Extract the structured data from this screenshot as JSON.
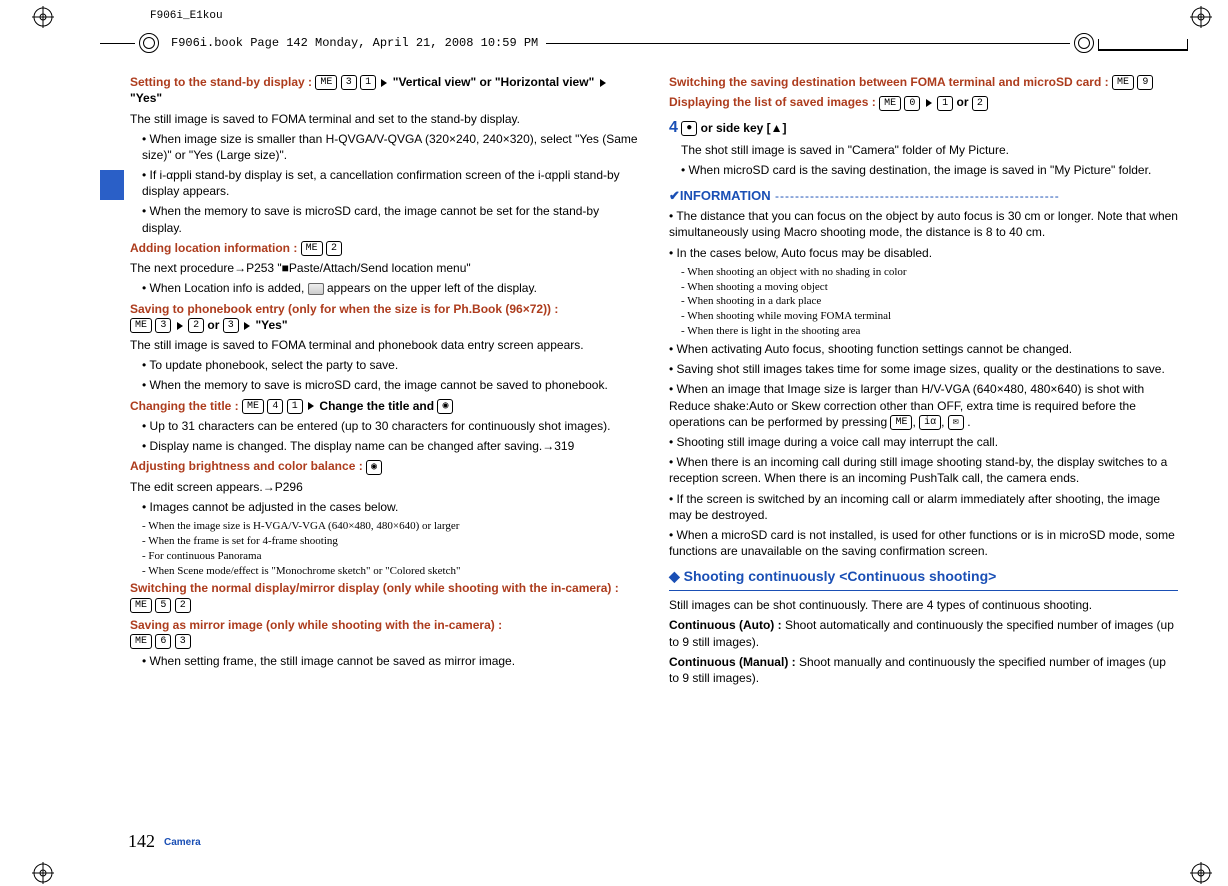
{
  "header": {
    "label": "F906i_E1kou"
  },
  "bookbar": {
    "text": "F906i.book  Page 142  Monday, April 21, 2008  10:59 PM"
  },
  "footer": {
    "num": "142",
    "cat": "Camera"
  },
  "left": {
    "standby_head": "Setting to the stand-by display : ",
    "standby_tail1": "\"Vertical view\" or \"Horizontal view\"",
    "standby_tail2": "\"Yes\"",
    "p1": "The still image is saved to FOMA terminal and set to the stand-by display.",
    "b1": "When image size is smaller than H-QVGA/V-QVGA (320×240, 240×320), select \"Yes (Same size)\" or \"Yes (Large size)\".",
    "b2a": "If i-",
    "b2b": "ppli stand-by display is set, a cancellation confirmation screen of the i-",
    "b2c": "ppli stand-by display appears.",
    "b3": "When the memory to save is microSD card, the image cannot be set for the stand-by display.",
    "addloc_head": "Adding location information : ",
    "addloc_p": "The next procedure→P253 \"■Paste/Attach/Send location menu\"",
    "addloc_b": "When Location info is added, ",
    "addloc_b2": " appears on the upper left of the display.",
    "savepb_head": "Saving to phonebook entry (only for when the size is for Ph.Book (96×72)) : ",
    "savepb_or": " or ",
    "savepb_yes": "\"Yes\"",
    "savepb_p": "The still image is saved to FOMA terminal and phonebook data entry screen appears.",
    "savepb_b1": "To update phonebook, select the party to save.",
    "savepb_b2": "When the memory to save is microSD card, the image cannot be saved to phonebook.",
    "chtitle_head": "Changing the title : ",
    "chtitle_tail": "Change the title and ",
    "chtitle_b1": "Up to 31 characters can be entered (up to 30 characters for continuously shot images).",
    "chtitle_b2": "Display name is changed. The display name can be changed after saving.→319",
    "adj_head": "Adjusting brightness and color balance : ",
    "adj_p": "The edit screen appears.→P296",
    "adj_b": "Images cannot be adjusted in the cases below.",
    "adj_s1": "- When the image size is H-VGA/V-VGA (640×480, 480×640) or larger",
    "adj_s2": "- When the frame is set for 4-frame shooting",
    "adj_s3": "- For continuous Panorama",
    "adj_s4": "- When Scene mode/effect is \"Monochrome sketch\" or \"Colored sketch\"",
    "mirror_head": "Switching the normal display/mirror display (only while shooting with the in-camera) : ",
    "savemirror_head": "Saving as mirror image (only while shooting with the in-camera) : ",
    "savemirror_b": "When setting frame, the still image cannot be saved as mirror image."
  },
  "right": {
    "switchdest_head": "Switching the saving destination between FOMA terminal and microSD card : ",
    "displist_head": "Displaying the list of saved images : ",
    "displist_or": " or ",
    "step4_btn": " or side key [▲]",
    "step4_p": "The shot still image is saved in \"Camera\" folder of My Picture.",
    "step4_b": "When microSD card is the saving destination, the image is saved in \"My Picture\" folder.",
    "info_title": "✔INFORMATION",
    "info_dash": " ---------------------------------------------------------",
    "i1": "The distance that you can focus on the object by auto focus is 30 cm or longer. Note that when simultaneously using Macro shooting mode, the distance is 8 to 40 cm.",
    "i2": "In the cases below, Auto focus may be disabled.",
    "i2s1": "- When shooting an object with no shading in color",
    "i2s2": "- When shooting a moving object",
    "i2s3": "- When shooting in a dark place",
    "i2s4": "- When shooting while moving FOMA terminal",
    "i2s5": "- When there is light in the shooting area",
    "i3": "When activating Auto focus, shooting function settings cannot be changed.",
    "i4": "Saving shot still images takes time for some image sizes, quality or the destinations to save.",
    "i5a": "When an image that Image size is larger than H/V-VGA (640×480, 480×640) is shot with Reduce shake:Auto or Skew correction other than OFF, extra time is required before the operations can be performed by pressing ",
    "i5b": ".",
    "i6": "Shooting still image during a voice call may interrupt the call.",
    "i7": "When there is an incoming call during still image shooting stand-by, the display switches to a reception screen. When there is an incoming PushTalk call, the camera ends.",
    "i8": "If the screen is switched by an incoming call or alarm immediately after shooting, the image may be destroyed.",
    "i9": "When a microSD card is not installed, is used for other functions or is in microSD mode, some functions are unavailable on the saving confirmation screen.",
    "cont_title": "◆ Shooting continuously <Continuous shooting>",
    "cont_p": "Still images can be shot continuously. There are 4 types of continuous shooting.",
    "cont_auto_h": "Continuous (Auto) : ",
    "cont_auto_t": "Shoot automatically and continuously the specified number of images (up to 9 still images).",
    "cont_man_h": "Continuous (Manual) : ",
    "cont_man_t": "Shoot manually and continuously the specified number of images (up to 9 still images)."
  },
  "keys": {
    "me": "ME",
    "n3": "3",
    "n1": "1",
    "n2": "2",
    "n4": "4",
    "n5": "5",
    "n6": "6",
    "n0": "0",
    "n9": "9",
    "cam": "◉",
    "ir": "iα",
    "mail": "✉",
    "center": "●"
  }
}
